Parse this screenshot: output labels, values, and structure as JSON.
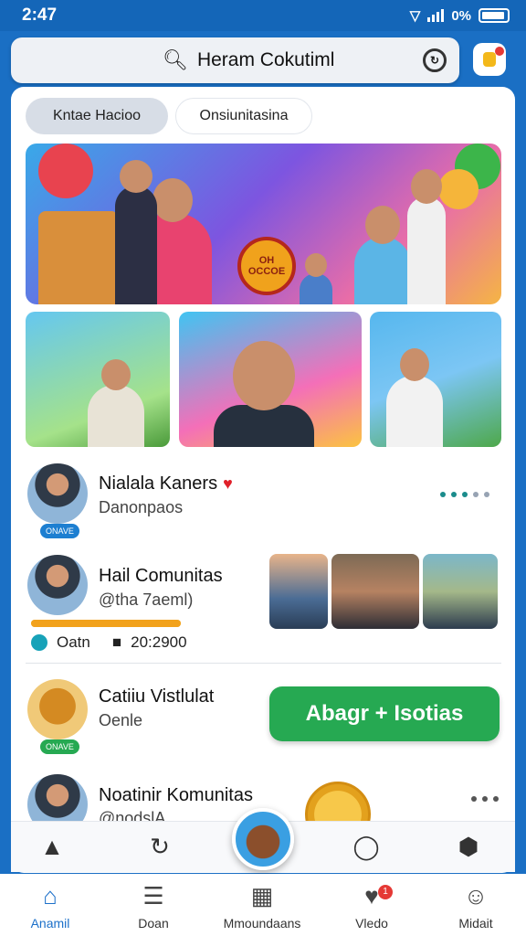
{
  "status_bar": {
    "time": "2:47",
    "network": "0%"
  },
  "search": {
    "text": "Heram Cokutiml"
  },
  "chips": [
    {
      "label": "Kntae Hacioo"
    },
    {
      "label": "Onsiunitasina"
    }
  ],
  "hero": {
    "badge_line1": "OH",
    "badge_line2": "OCCOE"
  },
  "list": [
    {
      "title": "Nialala Kaners",
      "subtitle": "Danonpaos",
      "badge": "ONAVE",
      "dot_colors": [
        "#1b8c8c",
        "#1b8c8c",
        "#1b8c8c",
        "#97a3b3",
        "#97a3b3"
      ]
    },
    {
      "title": "Hail Comunitas",
      "subtitle": "@tha 7aeml)",
      "stat_left": "Oatn",
      "stat_right": "20:2900",
      "progress": 1.0
    },
    {
      "title": "Catiiu Vistlulat",
      "subtitle": "Oenle",
      "badge": "ONAVE"
    },
    {
      "title": "Noatinir Komunitas",
      "subtitle": "@nodslA"
    }
  ],
  "cta": {
    "label": "Abagr + Isotias"
  },
  "bottom_nav": [
    {
      "label": "Anamil",
      "icon": "home-icon",
      "active": true
    },
    {
      "label": "Doan",
      "icon": "document-icon",
      "active": false
    },
    {
      "label": "Mmoundaans",
      "icon": "board-icon",
      "active": false
    },
    {
      "label": "Vledo",
      "icon": "video-icon",
      "active": false,
      "badge": "1"
    },
    {
      "label": "Midait",
      "icon": "profile-icon",
      "active": false
    }
  ],
  "colors": {
    "brand": "#1a6fc4",
    "accent_green": "#26a952",
    "active_nav": "#1c70c9"
  }
}
